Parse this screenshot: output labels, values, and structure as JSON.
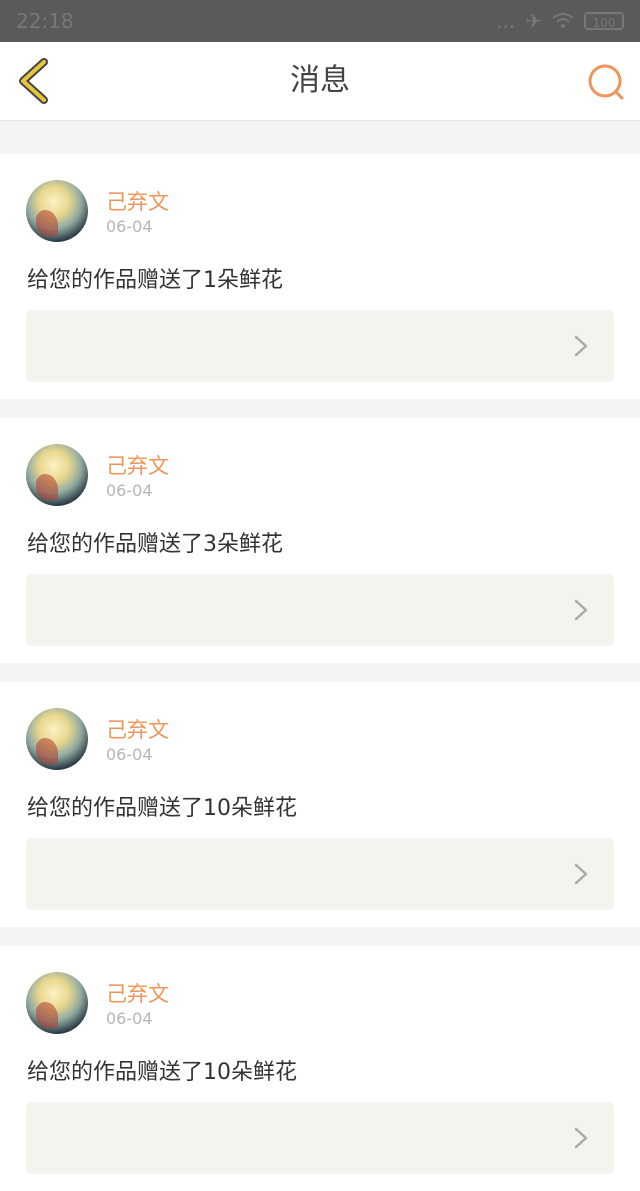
{
  "status_bar": {
    "time": "22:18",
    "signal": "...",
    "battery": "100"
  },
  "nav": {
    "title": "消息",
    "back_icon": "chevron-left-icon",
    "search_icon": "search-icon"
  },
  "messages": [
    {
      "username": "己弃文",
      "date": "06-04",
      "text": "给您的作品赠送了1朵鲜花"
    },
    {
      "username": "己弃文",
      "date": "06-04",
      "text": "给您的作品赠送了3朵鲜花"
    },
    {
      "username": "己弃文",
      "date": "06-04",
      "text": "给您的作品赠送了10朵鲜花"
    },
    {
      "username": "己弃文",
      "date": "06-04",
      "text": "给您的作品赠送了10朵鲜花"
    }
  ],
  "colors": {
    "accent": "#f0955a",
    "back_arrow": "#e8c63a",
    "page_bg": "#f4f4f4",
    "link_bg": "#f4f4ef"
  }
}
